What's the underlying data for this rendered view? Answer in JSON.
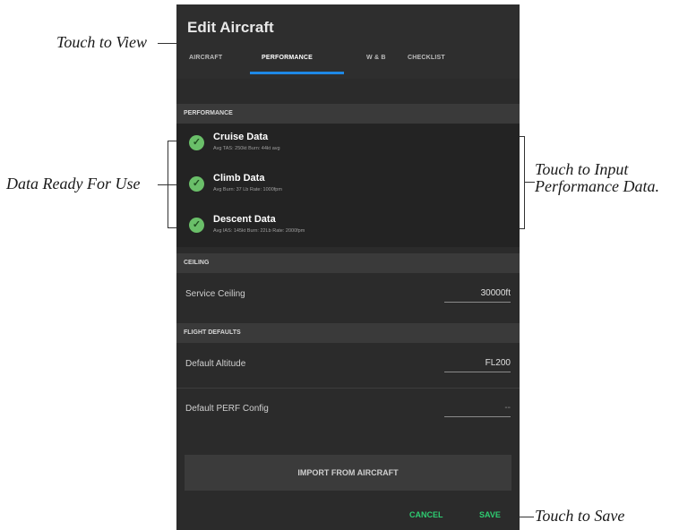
{
  "callouts": {
    "view": "Touch to View",
    "data_ready": "Data Ready For Use",
    "input_line1": "Touch to Input",
    "input_line2": "Performance Data.",
    "save": "Touch to Save"
  },
  "app": {
    "title": "Edit Aircraft"
  },
  "tabs": [
    {
      "label": "AIRCRAFT"
    },
    {
      "label": "PERFORMANCE",
      "active": true
    },
    {
      "label": "W & B"
    },
    {
      "label": "CHECKLIST"
    }
  ],
  "performance": {
    "header": "PERFORMANCE",
    "items": [
      {
        "title": "Cruise Data",
        "subtitle": "Avg TAS: 250kt Burn: 44kt avg",
        "status": "ready"
      },
      {
        "title": "Climb Data",
        "subtitle": "Avg Burn: 37 Lb Rate: 1000fpm",
        "status": "ready"
      },
      {
        "title": "Descent Data",
        "subtitle": "Avg IAS: 145kt Burn: 22Lb Rate: 2000fpm",
        "status": "ready"
      }
    ]
  },
  "ceiling": {
    "header": "CEILING",
    "service_ceiling_label": "Service Ceiling",
    "service_ceiling_value": "30000ft"
  },
  "flight_defaults": {
    "header": "FLIGHT DEFAULTS",
    "default_altitude_label": "Default Altitude",
    "default_altitude_value": "FL200",
    "default_perf_label": "Default PERF Config",
    "default_perf_value": "--"
  },
  "import_label": "IMPORT FROM AIRCRAFT",
  "actions": {
    "cancel": "CANCEL",
    "save": "SAVE"
  },
  "colors": {
    "accent_tab": "#1e88e5",
    "ready": "#6abf69",
    "action": "#2ecc71"
  }
}
